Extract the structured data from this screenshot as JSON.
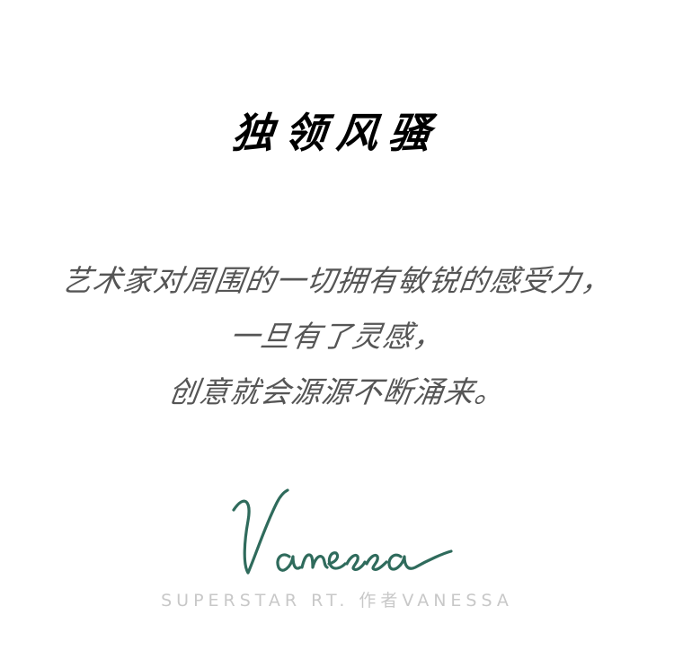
{
  "title": "独领风骚",
  "body": {
    "lines": [
      "艺术家对周围的一切拥有敏锐的感受力，",
      "一旦有了灵感，",
      "创意就会源源不断涌来。"
    ]
  },
  "signature": {
    "text": "Vanessa",
    "color": "#2f6b5c"
  },
  "subtitle": "SUPERSTAR RT. 作者VANESSA"
}
